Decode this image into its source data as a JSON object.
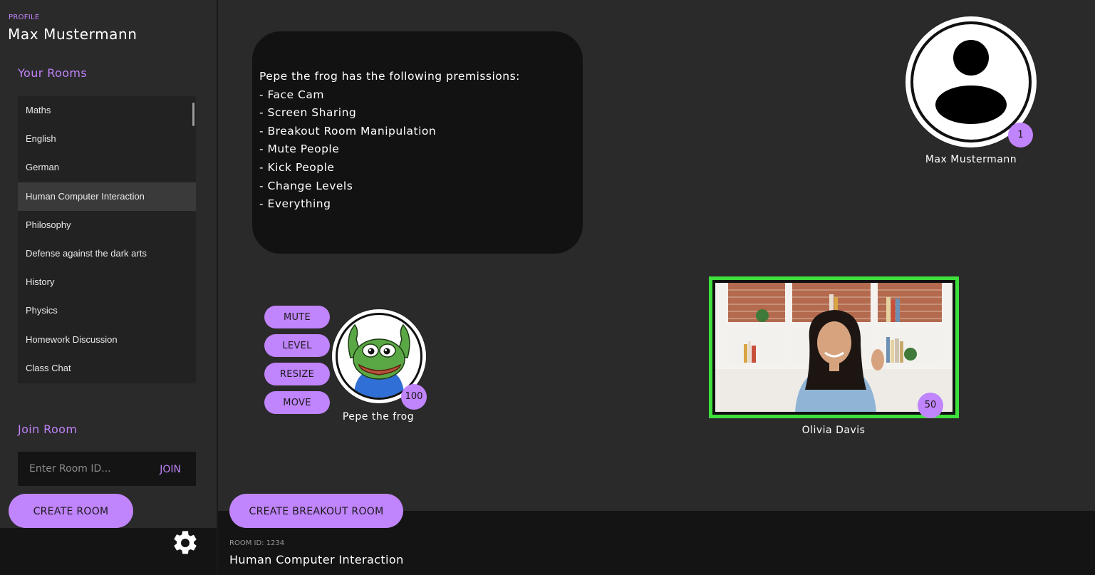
{
  "profile": {
    "caption": "PROFILE",
    "name": "Max Mustermann"
  },
  "sidebar": {
    "rooms_title": "Your Rooms",
    "rooms": [
      {
        "label": "Maths"
      },
      {
        "label": "English"
      },
      {
        "label": "German"
      },
      {
        "label": "Human Computer Interaction",
        "active": true
      },
      {
        "label": "Philosophy"
      },
      {
        "label": "Defense against the dark arts"
      },
      {
        "label": "History"
      },
      {
        "label": "Physics"
      },
      {
        "label": "Homework Discussion"
      },
      {
        "label": "Class Chat"
      }
    ],
    "join_title": "Join Room",
    "join_placeholder": "Enter Room ID...",
    "join_button": "JOIN",
    "create_room_button": "CREATE ROOM",
    "settings_icon": "gear-icon"
  },
  "room": {
    "id_label": "ROOM ID: 1234",
    "title": "Human Computer Interaction",
    "create_breakout_button": "CREATE BREAKOUT ROOM"
  },
  "permissions": {
    "heading": "Pepe the frog has the following premissions:",
    "items": [
      "- Face Cam",
      "- Screen Sharing",
      "- Breakout Room Manipulation",
      "- Mute People",
      "- Kick People",
      "- Change Levels",
      "- Everything"
    ]
  },
  "participants": {
    "max": {
      "name": "Max Mustermann",
      "level": "1",
      "icon": "user-silhouette-icon"
    },
    "pepe": {
      "name": "Pepe the frog",
      "level": "100",
      "icon": "pepe-frog-avatar"
    },
    "olivia": {
      "name": "Olivia Davis",
      "level": "50",
      "speaking_color": "#3de03d"
    }
  },
  "participant_actions": {
    "mute": "MUTE",
    "level": "LEVEL",
    "resize": "RESIZE",
    "move": "MOVE"
  },
  "colors": {
    "accent": "#c084fc",
    "background": "#2a2a2a",
    "panel": "#141414",
    "card": "#121212",
    "speaking_border": "#3de03d"
  }
}
